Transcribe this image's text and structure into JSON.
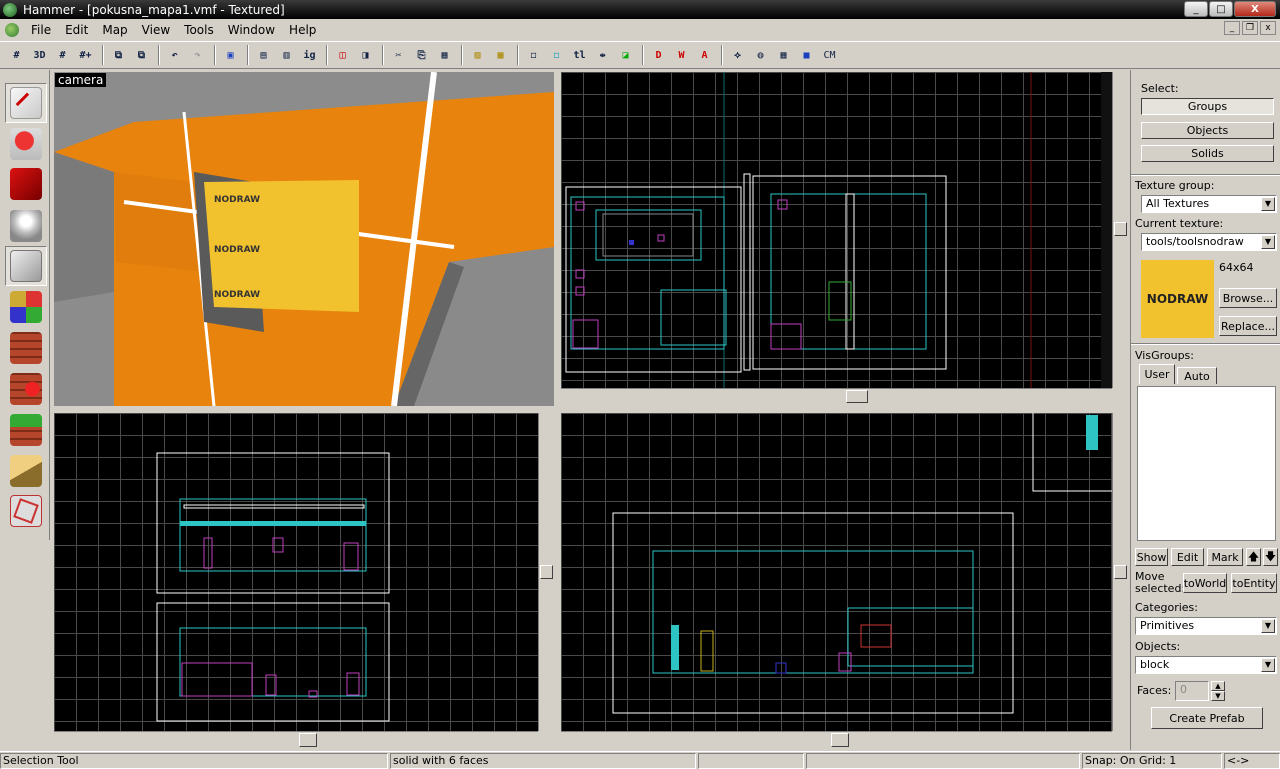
{
  "window": {
    "title": "Hammer - [pokusna_mapa1.vmf - Textured]",
    "minimize": "_",
    "maximize": "□",
    "close": "X"
  },
  "menu": [
    "File",
    "Edit",
    "Map",
    "View",
    "Tools",
    "Window",
    "Help"
  ],
  "mdi": {
    "minimize": "_",
    "restore": "❐",
    "close": "x"
  },
  "toolbar": {
    "btns": [
      "#",
      "3D",
      "#",
      "#+",
      "⧉",
      "⧉",
      "↶",
      "↷",
      "▣",
      "▤",
      "▥",
      "ig",
      "◫",
      "◨",
      "✂",
      "⎘",
      "▦",
      "▨",
      "▩",
      "◻",
      "◻",
      "tl",
      "⇹",
      "◪",
      "D",
      "W",
      "A",
      "⟡",
      "◍",
      "▦",
      "■",
      "CM"
    ]
  },
  "left_tools": [
    "Selection Tool",
    "Magnify",
    "Camera",
    "Entity Tool",
    "Block Tool",
    "Texture Application",
    "Apply Current Texture",
    "Decal Tool",
    "Overlay Tool",
    "Clipping Tool",
    "Vertex Tool"
  ],
  "camera": {
    "label": "camera"
  },
  "panel": {
    "select_label": "Select:",
    "select_buttons": [
      "Groups",
      "Objects",
      "Solids"
    ],
    "texture_group_label": "Texture group:",
    "texture_group_value": "All Textures",
    "current_texture_label": "Current texture:",
    "current_texture_value": "tools/toolsnodraw",
    "texture_preview_text": "NODRAW",
    "texture_size": "64x64",
    "browse": "Browse...",
    "replace": "Replace...",
    "visgroups_label": "VisGroups:",
    "tabs": [
      "User",
      "Auto"
    ],
    "vis_buttons": [
      "Show",
      "Edit",
      "Mark"
    ],
    "up": "🡅",
    "down": "🡇",
    "move_selected": "Move selected:",
    "to_world": "toWorld",
    "to_entity": "toEntity",
    "categories_label": "Categories:",
    "categories_value": "Primitives",
    "objects_label": "Objects:",
    "objects_value": "block",
    "faces_label": "Faces:",
    "faces_value": "0",
    "create_prefab": "Create Prefab"
  },
  "statusbar": {
    "tool": "Selection Tool",
    "selection": "solid with 6 faces",
    "snap": "Snap: On Grid: 1",
    "arrows": "<->"
  },
  "colors": {
    "orange": "#e8840e",
    "nodraw_yellow": "#f2c12e",
    "cyan": "#2ec4c4",
    "magenta": "#c040c0"
  }
}
